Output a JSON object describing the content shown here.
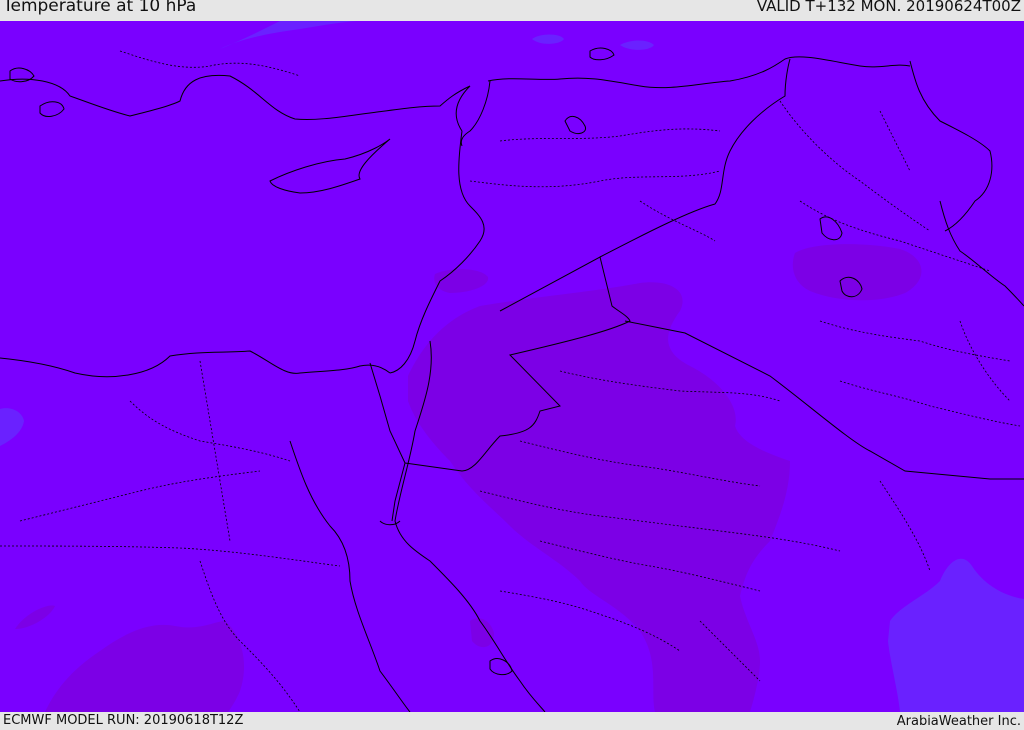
{
  "header": {
    "title": "Temperature at 10 hPa",
    "valid": "VALID T+132 MON. 20190624T00Z"
  },
  "footer": {
    "model_run": "ECMWF MODEL RUN: 20190618T12Z",
    "brand": "ArabiaWeather Inc."
  },
  "map": {
    "fill_colors": {
      "base": "#7a00ff",
      "warm": "#7c00e6",
      "cool": "#6a21ff",
      "cool_light": "#5d3bff"
    },
    "line_color": "#000000"
  }
}
